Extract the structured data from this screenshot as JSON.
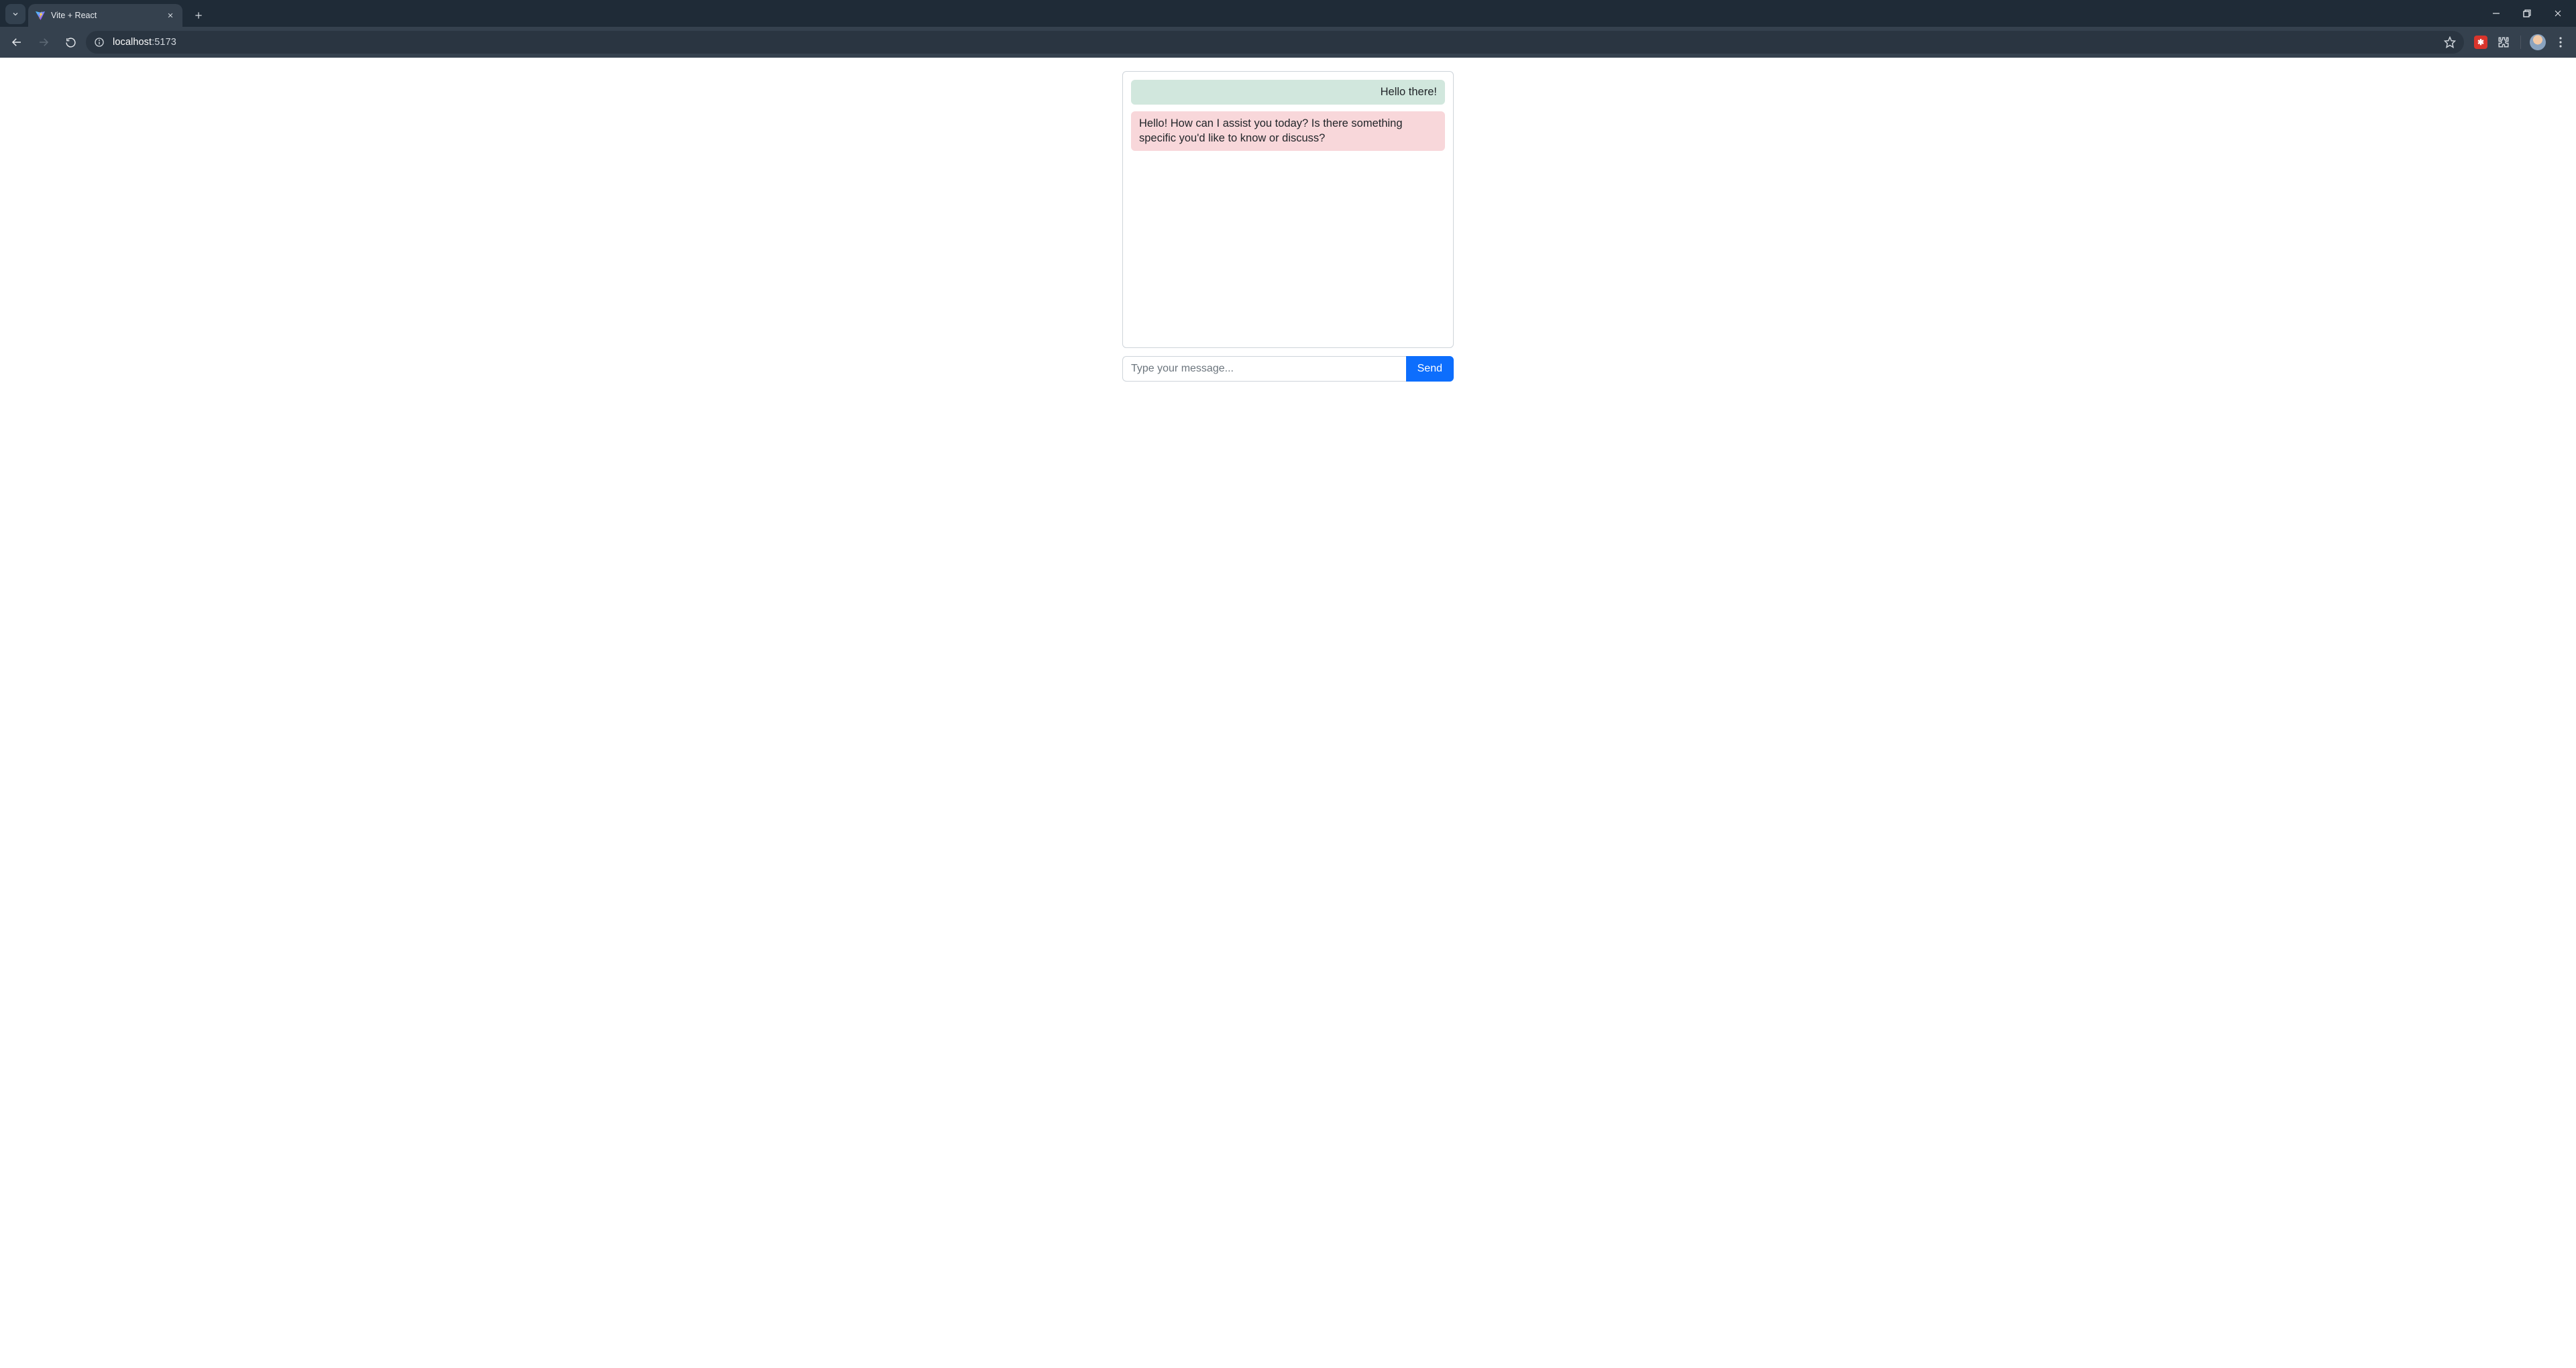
{
  "browser": {
    "tab_title": "Vite + React",
    "url_host": "localhost",
    "url_rest": ":5173"
  },
  "chat": {
    "messages": [
      {
        "role": "user",
        "text": "Hello there!"
      },
      {
        "role": "bot",
        "text": "Hello! How can I assist you today? Is there something specific you'd like to know or discuss?"
      }
    ],
    "input_value": "",
    "input_placeholder": "Type your message...",
    "send_label": "Send"
  },
  "colors": {
    "user_msg_bg": "#d1e7dd",
    "bot_msg_bg": "#f8d7da",
    "send_bg": "#0d6efd"
  }
}
